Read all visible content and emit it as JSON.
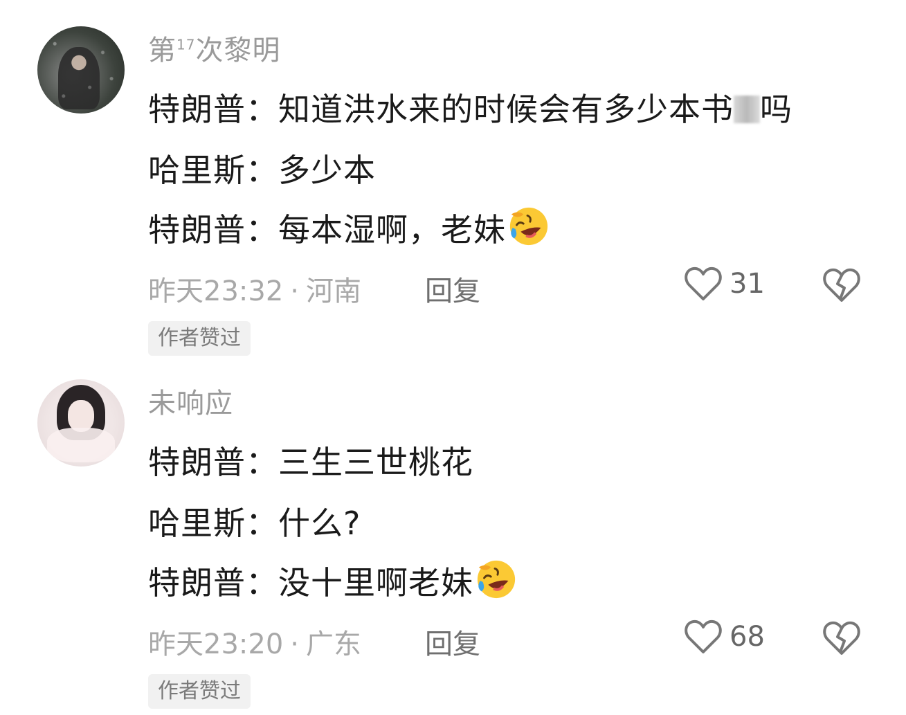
{
  "comments": [
    {
      "username_main": "第",
      "username_sup": "17",
      "username_tail": "次黎明",
      "lines": [
        {
          "speaker": "特朗普：",
          "text_a": "知道洪水来的时候会有多少本书",
          "text_b": "吗"
        },
        {
          "speaker": "哈里斯：",
          "text": "多少本"
        },
        {
          "speaker": "特朗普：",
          "text": "每本湿啊，老妹"
        }
      ],
      "time": "昨天23:32",
      "dot": "·",
      "location": "河南",
      "reply_label": "回复",
      "like_count": "31",
      "badge": "作者赞过"
    },
    {
      "username": "未响应",
      "lines": [
        {
          "speaker": "特朗普：",
          "text": "三生三世桃花"
        },
        {
          "speaker": "哈里斯：",
          "text": "什么?"
        },
        {
          "speaker": "特朗普：",
          "text": "没十里啊老妹"
        }
      ],
      "time": "昨天23:20",
      "dot": "·",
      "location": "广东",
      "reply_label": "回复",
      "like_count": "68",
      "badge": "作者赞过"
    }
  ],
  "icons": {
    "like": "heart-outline-icon",
    "dislike": "broken-heart-icon",
    "emoji": "rolling-on-floor-laughing-emoji"
  },
  "colors": {
    "username": "#9a9a9a",
    "text": "#1a1a1a",
    "meta": "#a8a8a8",
    "badge_bg": "#f1f1f1",
    "emoji_yellow": "#fbc934"
  }
}
